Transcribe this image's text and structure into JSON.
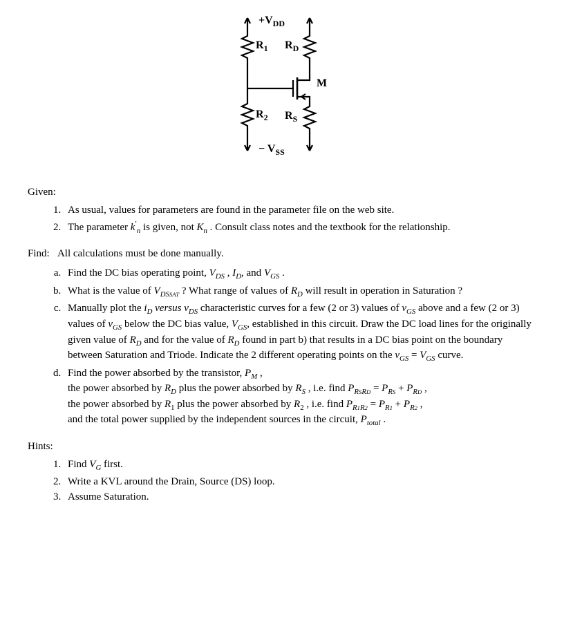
{
  "figure": {
    "vdd": "+V",
    "vdd_sub": "DD",
    "r1": "R",
    "r1_sub": "1",
    "rd": "R",
    "rd_sub": "D",
    "m": "M",
    "r2": "R",
    "r2_sub": "2",
    "rs": "R",
    "rs_sub": "S",
    "vss": "− V",
    "vss_sub": "SS"
  },
  "given_label": "Given:",
  "given": {
    "item1": "As usual, values for parameters are found in the parameter file on the web site.",
    "item2_a": "The parameter ",
    "item2_k": "k",
    "item2_prime": "′",
    "item2_n": "n",
    "item2_b": " is given, not ",
    "item2_K": "K",
    "item2_n2": "n",
    "item2_c": " . Consult class notes and the textbook for the relationship."
  },
  "find_label": "Find:",
  "find_text": "All calculations must be done manually.",
  "parts": {
    "a": {
      "t1": "Find the DC bias operating point, ",
      "vds": "V",
      "vds_sub": "DS",
      "sep1": " , ",
      "id": "I",
      "id_sub": "D",
      "sep2": ", and ",
      "vgs": "V",
      "vgs_sub": "GS",
      "end": " ."
    },
    "b": {
      "t1": "What is the value of ",
      "vdssat": "V",
      "vdssat_sub": "DS",
      "vdssat_sub2": "SAT",
      "t2": " ? What range of values of ",
      "rd": "R",
      "rd_sub": "D",
      "t3": " will result in operation in Saturation ?"
    },
    "c": {
      "t1": "Manually plot the ",
      "id": "i",
      "id_sub": "D",
      "t2": " versus ",
      "vds": "v",
      "vds_sub": "DS",
      "t3": " characteristic curves for a few (2 or 3) values of ",
      "vgs": "v",
      "vgs_sub": "GS",
      "t4": " above and a few (2 or 3) values of ",
      "vgs2": "v",
      "vgs2_sub": "GS",
      "t5": " below the DC bias value, ",
      "Vgs": "V",
      "Vgs_sub": "GS",
      "t6": ", established in this circuit. Draw the DC load lines for the originally given value of ",
      "rd": "R",
      "rd_sub": "D",
      "t7": "  and for the value of  ",
      "rd2": "R",
      "rd2_sub": "D",
      "t8": " found in part b) that results in a DC bias point on the boundary between Saturation and Triode. Indicate the 2 different operating points on the ",
      "vgs3": "v",
      "vgs3_sub": "GS",
      "eq": " = ",
      "Vgs2": "V",
      "Vgs2_sub": "GS",
      "t9": " curve."
    },
    "d": {
      "t1": "Find the power absorbed by the transistor, ",
      "pm": "P",
      "pm_sub": "M",
      "t2": " ,",
      "t3": "the power absorbed by ",
      "rd": "R",
      "rd_sub": "D",
      "t4": " plus the power absorbed by ",
      "rs": "R",
      "rs_sub": "S",
      "t5": "  , i.e. find ",
      "prsrd": "P",
      "prsrd_sub": "R",
      "prsrd_sub2": "S",
      "prsrd_subR": "R",
      "prsrd_subD": "D",
      "eq1": " = ",
      "prs": "P",
      "prs_sub": "R",
      "prs_sub2": "S",
      "plus": " + ",
      "prd": "P",
      "prd_sub": "R",
      "prd_sub2": "D",
      "t6": "  ,",
      "t7": "the power absorbed by ",
      "r1": "R",
      "r1_sub": "1",
      "t8": " plus the power absorbed by ",
      "r2": "R",
      "r2_sub": "2",
      "t9": "  , i.e. find ",
      "pr1r2": "P",
      "pr1r2_subR1": "R",
      "pr1r2_sub1": "1",
      "pr1r2_subR2": "R",
      "pr1r2_sub2": "2",
      "eq2": " = ",
      "pr1": "P",
      "pr1_subR": "R",
      "pr1_sub1": "1",
      "plus2": " + ",
      "pr2": "P",
      "pr2_subR": "R",
      "pr2_sub2": "2",
      "t10": "  ,",
      "t11": "and the total power supplied by the independent sources in the circuit, ",
      "ptot": "P",
      "ptot_sub": "total",
      "t12": "  ."
    }
  },
  "hints_label": "Hints:",
  "hints": {
    "h1a": "Find ",
    "h1_vg": "V",
    "h1_vg_sub": "G",
    "h1b": " first.",
    "h2": "Write a KVL around the Drain, Source (DS) loop.",
    "h3": "Assume Saturation."
  }
}
